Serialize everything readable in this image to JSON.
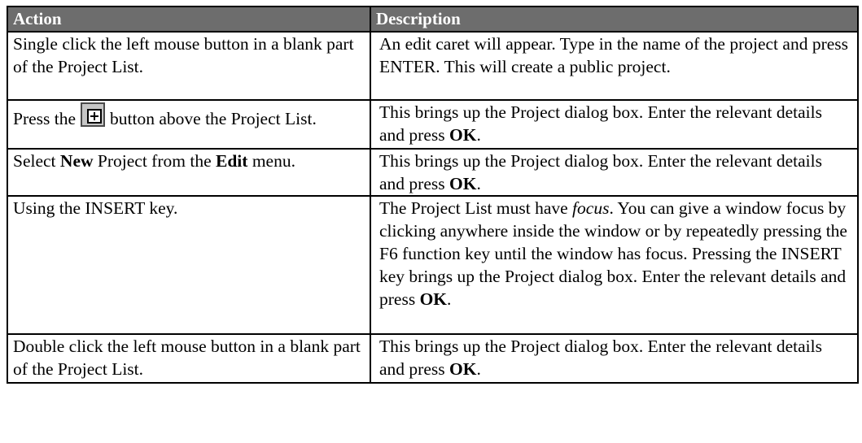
{
  "header": {
    "action": "Action",
    "description": "Description"
  },
  "rows": [
    {
      "action": {
        "text": "Single click the left mouse button in a blank part of the Project List."
      },
      "description": {
        "text": "An edit caret will appear. Type in the name of the project and press ENTER. This will create a public project."
      }
    },
    {
      "action": {
        "pre": "Press the",
        "icon": "expand-plus-icon",
        "post": "button above the Project List."
      },
      "description": {
        "pre": "This brings up the Project dialog box. Enter the relevant details and press ",
        "bold": "OK",
        "post": "."
      }
    },
    {
      "action": {
        "pre": "Select ",
        "bold1": "New",
        "mid": " Project from the ",
        "bold2": "Edit",
        "post": " menu."
      },
      "description": {
        "pre": "This brings up the Project dialog box. Enter the relevant details and press ",
        "bold": "OK",
        "post": "."
      }
    },
    {
      "action": {
        "text": "Using the INSERT key."
      },
      "description": {
        "pre": "The Project List must have ",
        "italic": "focus",
        "mid": ". You can give a window focus by clicking anywhere inside the window or by repeatedly pressing the F6 function key until the window has focus. Pressing the INSERT key brings up the Project dialog box. Enter the relevant details and press ",
        "bold": "OK",
        "post": "."
      }
    },
    {
      "action": {
        "text": "Double click the left mouse button in a blank part of the Project List."
      },
      "description": {
        "pre": "This brings up the Project dialog box. Enter the relevant details and press ",
        "bold": "OK",
        "post": "."
      }
    }
  ]
}
